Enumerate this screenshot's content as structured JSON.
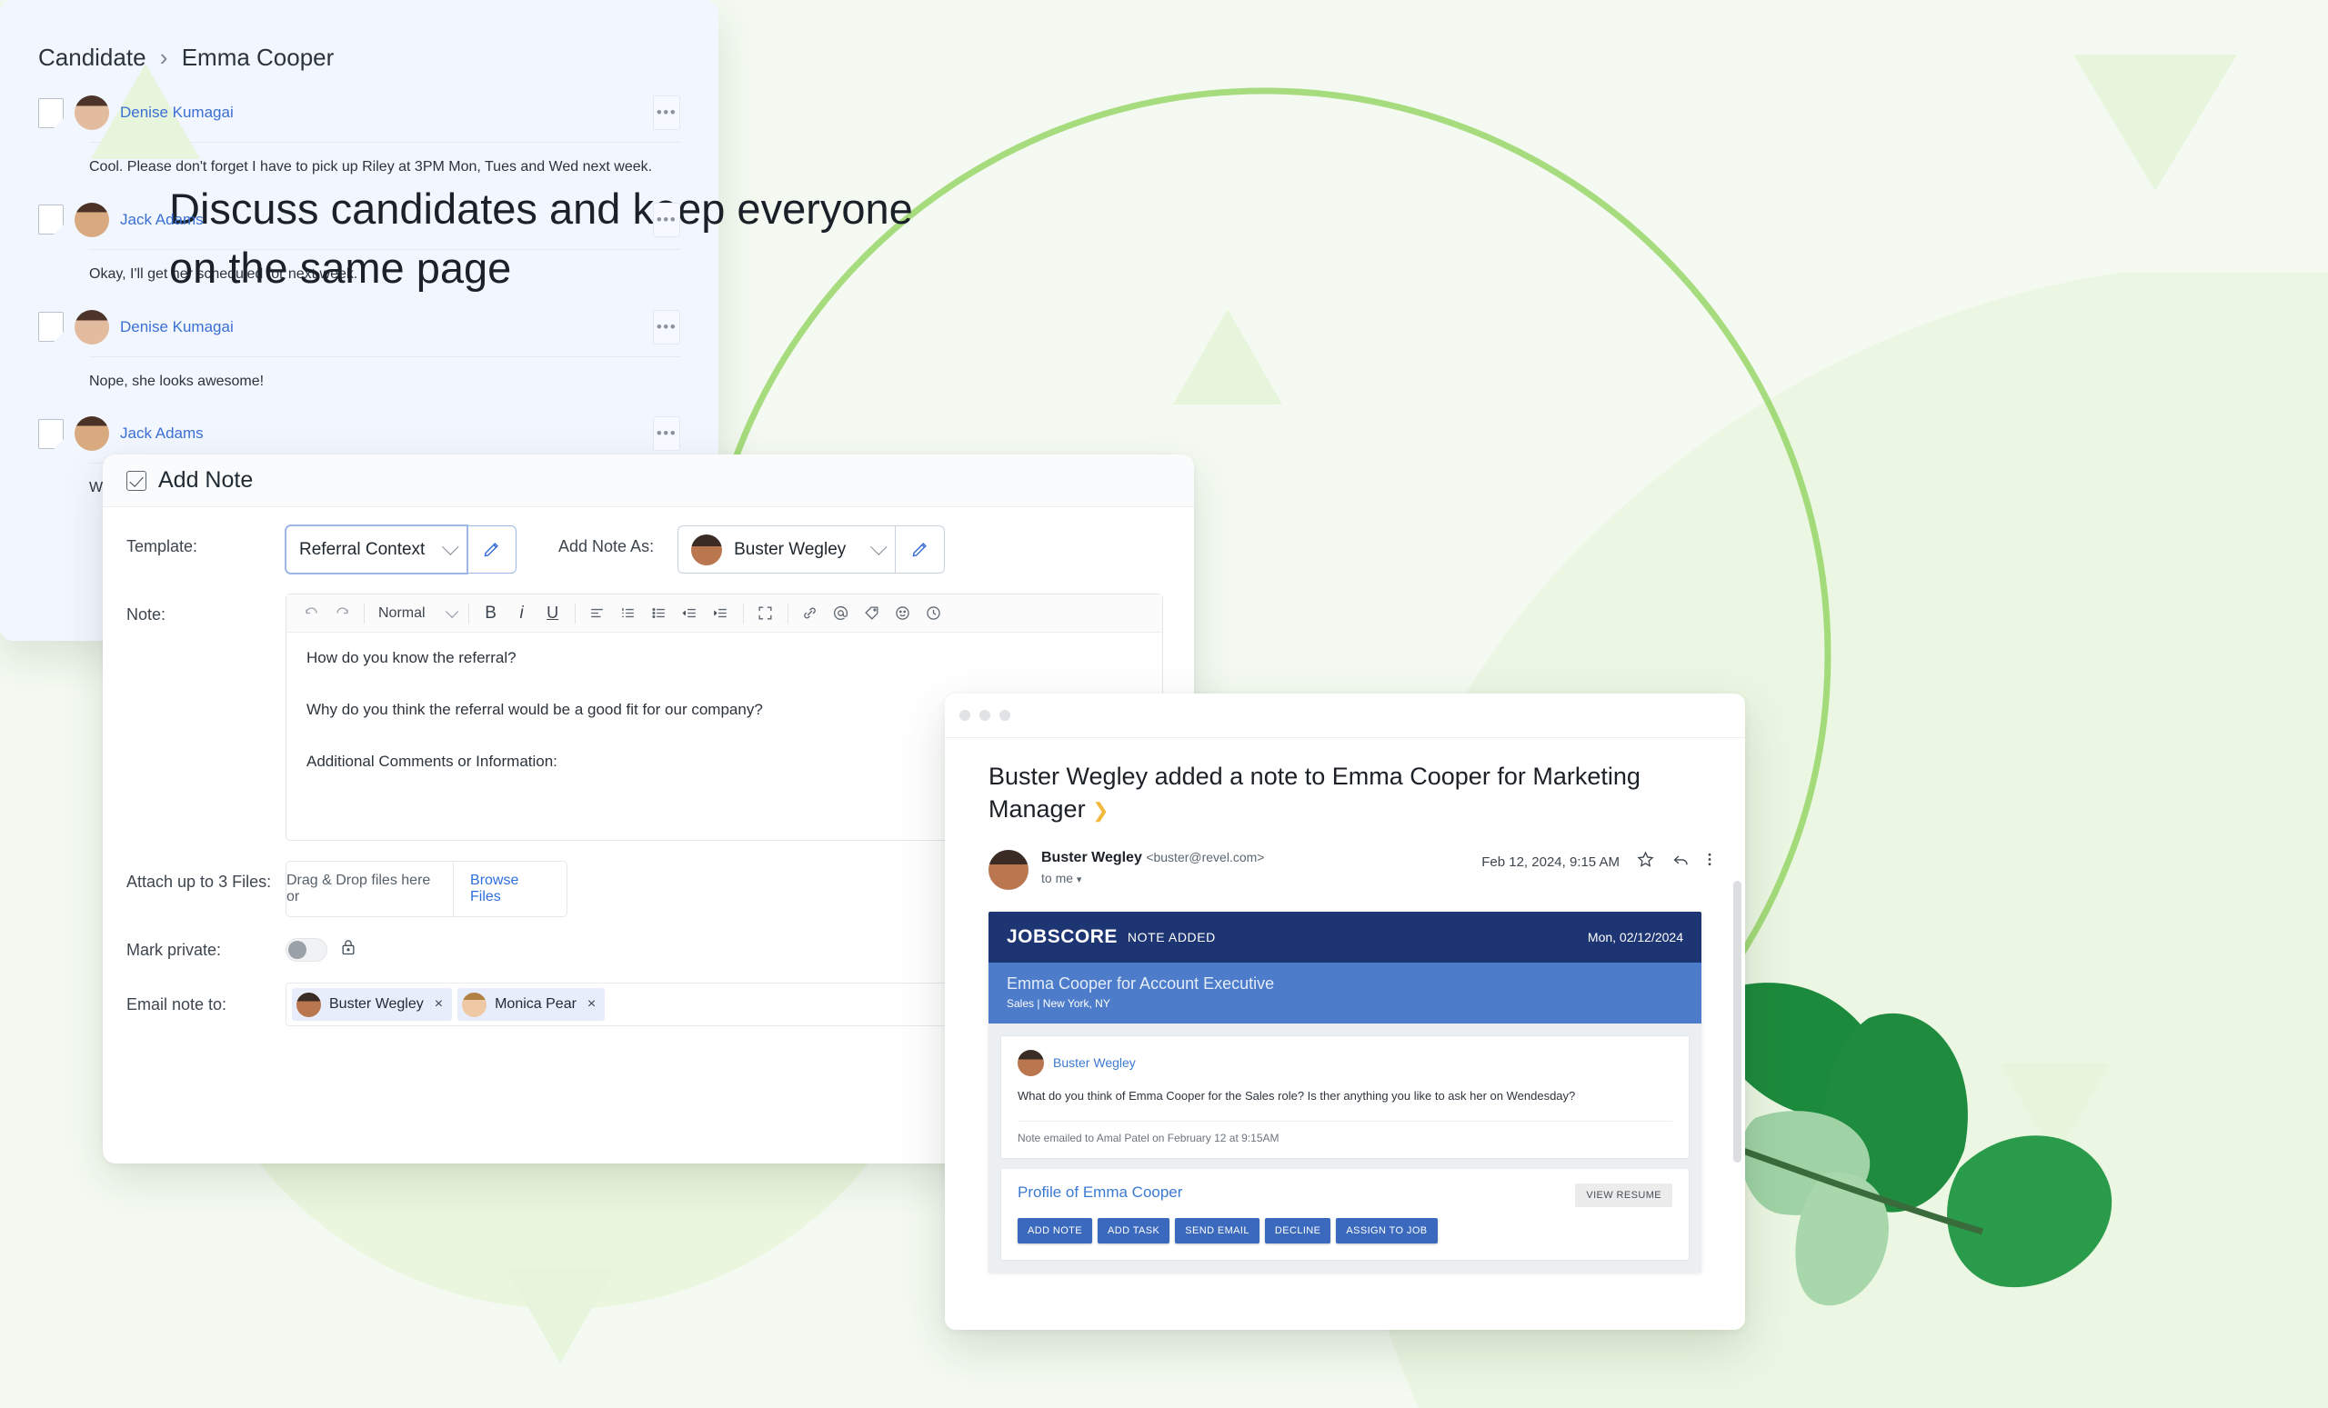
{
  "hero": {
    "headline_line1": "Discuss candidates and keep everyone",
    "headline_line2": "on the same page"
  },
  "add_note_panel": {
    "title": "Add Note",
    "checkbox_checked": true,
    "template": {
      "label": "Template:",
      "value": "Referral Context",
      "edit_icon": "pencil-icon",
      "chevron": "chevron-down-icon"
    },
    "add_note_as": {
      "label": "Add Note As:",
      "value": "Buster Wegley",
      "edit_icon": "pencil-icon",
      "chevron": "chevron-down-icon"
    },
    "note": {
      "label": "Note:",
      "toolbar": {
        "undo": "undo-icon",
        "redo": "redo-icon",
        "style_value": "Normal",
        "bold": "B",
        "italic": "i",
        "underline": "U",
        "align": "align-left-icon",
        "ordered_list": "ordered-list-icon",
        "bullet_list": "bullet-list-icon",
        "outdent": "outdent-icon",
        "indent": "indent-icon",
        "fullscreen": "fullscreen-icon",
        "link": "link-icon",
        "mention": "at-mention-icon",
        "tag": "tag-icon",
        "emoji": "emoji-icon",
        "clock": "clock-icon"
      },
      "body_lines": [
        "How do you know the referral?",
        "Why do you think the referral would be a good fit for our company?",
        "Additional Comments or Information:"
      ]
    },
    "attach": {
      "label": "Attach up to 3 Files:",
      "dropzone_text": "Drag & Drop files here or",
      "browse_label": "Browse Files"
    },
    "mark_private": {
      "label": "Mark private:",
      "toggle_on": false,
      "lock_icon": "lock-icon"
    },
    "email_note_to": {
      "label": "Email note to:",
      "chips": [
        {
          "name": "Buster Wegley",
          "remove": "×"
        },
        {
          "name": "Monica Pear",
          "remove": "×"
        }
      ]
    }
  },
  "email_window": {
    "window_dots": 3,
    "subject": "Buster Wegley added a note to Emma Cooper for Marketing Manager",
    "subject_marker": "❯",
    "sender_name": "Buster Wegley",
    "sender_email": "<buster@revel.com>",
    "to_line": "to me",
    "date": "Feb 12, 2024, 9:15 AM",
    "icons": {
      "star": "star-icon",
      "reply": "reply-icon",
      "more": "more-vertical-icon"
    },
    "jobscore": {
      "logo_job": "JOB",
      "logo_score": "SCORE",
      "note_added": "NOTE ADDED",
      "date": "Mon, 02/12/2024",
      "candidate_line": "Emma Cooper for Account Executive",
      "department_line": "Sales | New York, NY",
      "author": "Buster Wegley",
      "note_text": "What do you think of Emma Cooper for the Sales role? Is ther anything you like to ask her on Wendesday?",
      "emailed_note": "Note emailed to Amal Patel on February 12 at 9:15AM",
      "profile_prefix": "Profile of",
      "profile_name": "Emma Cooper",
      "view_resume": "VIEW RESUME",
      "actions": [
        "ADD NOTE",
        "ADD TASK",
        "SEND EMAIL",
        "DECLINE",
        "ASSIGN TO JOB"
      ]
    }
  },
  "discussion_panel": {
    "breadcrumb_root": "Candidate",
    "breadcrumb_sep": "›",
    "breadcrumb_current": "Emma Cooper",
    "items": [
      {
        "author": "Denise Kumagai",
        "avatar": "denise-avatar",
        "text": "Cool.  Please don't forget I have to pick up Riley at 3PM Mon, Tues and Wed next week.",
        "menu": "•••"
      },
      {
        "author": "Jack Adams",
        "avatar": "jack-avatar",
        "text": "Okay, I'll get her scheduled for next week.",
        "menu": "•••"
      },
      {
        "author": "Denise Kumagai",
        "avatar": "denise-avatar",
        "text": "Nope, she looks awesome!",
        "menu": "•••"
      },
      {
        "author": "Jack Adams",
        "avatar": "jack-avatar",
        "text": "What do you think of Emma Cooper for Marketing Manager?  She too senior?",
        "menu": "•••"
      }
    ]
  },
  "colors": {
    "page_bg": "#f4faf1",
    "accent_blue": "#3b6fd4",
    "jobscore_navy": "#1d3572",
    "jobscore_blue": "#4d7ccb",
    "button_blue": "#3a69bd",
    "decor_green": "#e6f5dc",
    "decor_line_green": "#8fd35c",
    "panel_bg": "#f2f6fe"
  }
}
